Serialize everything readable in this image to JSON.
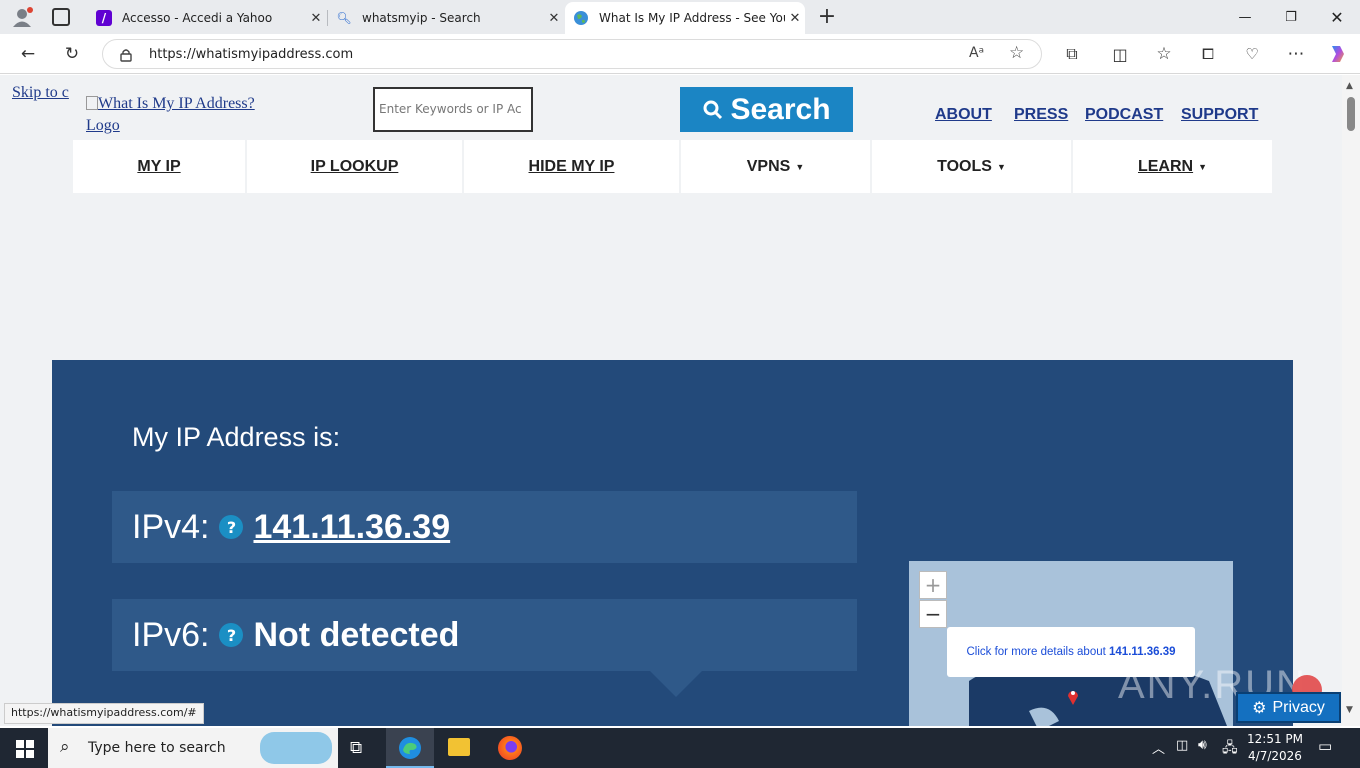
{
  "browser": {
    "tabs": [
      {
        "label": "Accesso - Accedi a Yahoo",
        "icon": "yahoo-icon"
      },
      {
        "label": "whatsmyip - Search",
        "icon": "search-icon"
      },
      {
        "label": "What Is My IP Address - See Your",
        "icon": "globe-icon"
      }
    ],
    "url": "https://whatismyipaddress.com",
    "status_url": "https://whatismyipaddress.com/#"
  },
  "site": {
    "skip_link": "Skip to c",
    "logo_alt": "What Is My IP Address? Logo",
    "search_placeholder": "Enter Keywords or IP Ac",
    "search_button": "Search",
    "top_links": [
      "ABOUT",
      "PRESS",
      "PODCAST",
      "SUPPORT"
    ],
    "nav": [
      {
        "label": "MY IP",
        "dropdown": false
      },
      {
        "label": "IP LOOKUP",
        "dropdown": false
      },
      {
        "label": "HIDE MY IP",
        "dropdown": false
      },
      {
        "label": "VPNS",
        "dropdown": true
      },
      {
        "label": "TOOLS",
        "dropdown": true
      },
      {
        "label": "LEARN",
        "dropdown": true
      }
    ],
    "hero": {
      "heading": "My IP Address is:",
      "ipv4_label": "IPv4:",
      "ipv4_value": "141.11.36.39",
      "ipv6_label": "IPv6:",
      "ipv6_value": "Not detected",
      "map_popup_prefix": "Click for more details about",
      "map_popup_ip": "141.11.36.39",
      "zoom_in": "+",
      "zoom_out": "−"
    },
    "privacy_button": "Privacy",
    "watermark": "ANY.RUN"
  },
  "taskbar": {
    "search_placeholder": "Type here to search",
    "time": "12:51 PM",
    "date": "4/7/2026"
  },
  "colors": {
    "hero_bg": "#234a7a",
    "ip_row_bg": "#2f5989",
    "search_btn": "#1b85c4",
    "link": "#1f3a8a"
  }
}
